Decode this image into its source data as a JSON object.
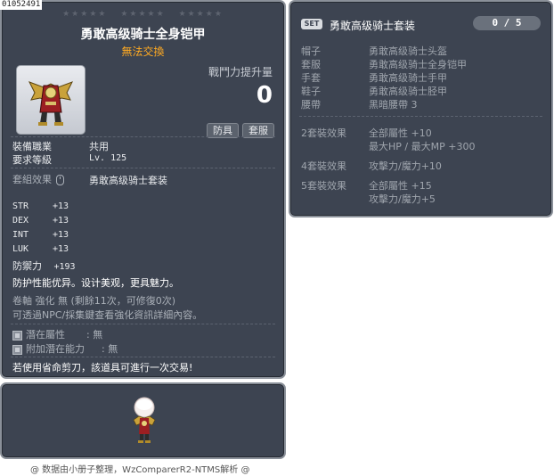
{
  "item_id": "01052491",
  "main": {
    "star_groups": [
      "★★★★★",
      "★★★★★",
      "★★★★★"
    ],
    "title": "勇敢高级骑士全身铠甲",
    "subtitle": "無法交換",
    "combat_power_label": "戰鬥力提升量",
    "combat_power_value": "0",
    "tags": [
      "防具",
      "套服"
    ],
    "job_label": "裝備職業",
    "job_value": "共用",
    "level_label": "要求等級",
    "level_value": "Lv. 125",
    "set_effect_label": "套組效果",
    "set_effect_value": "勇敢高级骑士套装",
    "stats": [
      {
        "name": "STR",
        "value": "+13"
      },
      {
        "name": "DEX",
        "value": "+13"
      },
      {
        "name": "INT",
        "value": "+13"
      },
      {
        "name": "LUK",
        "value": "+13"
      }
    ],
    "defense_label": "防禦力",
    "defense_value": "+193",
    "description": "防护性能优异。设计美观，更具魅力。",
    "scroll_line": "卷軸 強化 無 (剩餘11次，可修復0次)",
    "scroll_hint": "可透過NPC/採集鍵查看強化資訊詳細內容。",
    "potential_label": "潛在屬性",
    "potential_value": ": 無",
    "bonus_potential_label": "附加潛在能力",
    "bonus_potential_value": ": 無",
    "trade_note": "若使用省命剪刀，該道具可進行一次交易!"
  },
  "set_panel": {
    "badge": "SET",
    "title": "勇敢高级骑士套装",
    "count": "0 / 5",
    "pieces": [
      {
        "slot": "帽子",
        "name": "勇敢高级骑士头盔"
      },
      {
        "slot": "套服",
        "name": "勇敢高级骑士全身铠甲"
      },
      {
        "slot": "手套",
        "name": "勇敢高级骑士手甲"
      },
      {
        "slot": "鞋子",
        "name": "勇敢高级骑士胫甲"
      },
      {
        "slot": "腰帶",
        "name": "黑暗腰帶 3"
      }
    ],
    "effects": [
      {
        "label": "2套裝效果",
        "lines": [
          "全部屬性 +10",
          "最大HP / 最大MP  +300"
        ]
      },
      {
        "label": "4套裝效果",
        "lines": [
          "攻擊力/魔力+10"
        ]
      },
      {
        "label": "5套裝效果",
        "lines": [
          "全部屬性 +15",
          "攻擊力/魔力+5"
        ]
      }
    ]
  },
  "credit": "@ 数据由小册子整理，WzComparerR2-NTMS解析 @",
  "colors": {
    "panel_bg": "#3d4451",
    "panel_border": "#8a9099",
    "untradeable": "#ffaa22"
  }
}
